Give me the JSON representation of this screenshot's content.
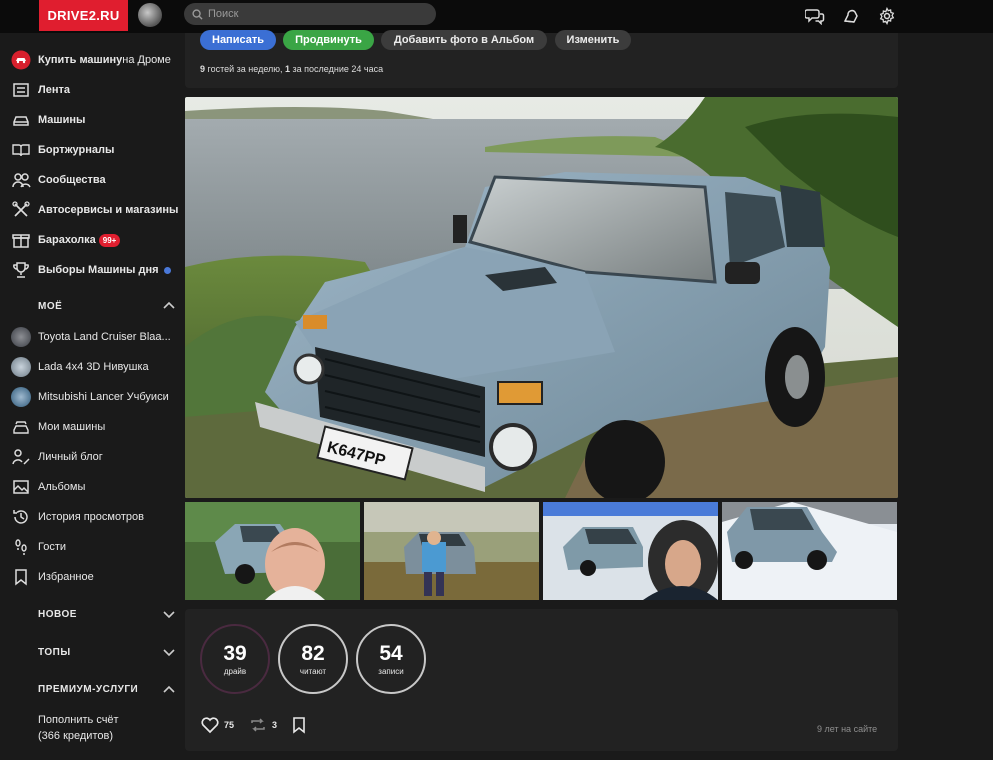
{
  "header": {
    "logo": "DRIVE2.RU",
    "search_placeholder": "Поиск"
  },
  "sidebar": {
    "items": [
      {
        "label_bold": "Купить машину",
        "label_normal": " на Дроме"
      },
      {
        "label": "Лента"
      },
      {
        "label": "Машины"
      },
      {
        "label": "Бортжурналы"
      },
      {
        "label": "Сообщества"
      },
      {
        "label": "Автосервисы и магазины"
      },
      {
        "label": "Барахолка",
        "badge": "99+"
      },
      {
        "label": "Выборы Машины дня"
      }
    ],
    "section_mine": "МОЁ",
    "mine": [
      {
        "label": "Toyota Land Cruiser Blaa..."
      },
      {
        "label": "Lada 4x4 3D Нивушка"
      },
      {
        "label": "Mitsubishi Lancer Учбуиси"
      },
      {
        "label": "Мои машины"
      },
      {
        "label": "Личный блог"
      },
      {
        "label": "Альбомы"
      },
      {
        "label": "История просмотров"
      },
      {
        "label": "Гости"
      },
      {
        "label": "Избранное"
      }
    ],
    "section_new": "НОВОЕ",
    "section_tops": "ТОПЫ",
    "section_premium": "ПРЕМИУМ-УСЛУГИ",
    "credits_line1": "Пополнить счёт",
    "credits_line2": "(366 кредитов)"
  },
  "actions_top": {
    "write": "Написать",
    "promote": "Продвинуть",
    "add_photo": "Добавить фото в Альбом",
    "edit": "Изменить",
    "guests_week": "9",
    "guests_week_text": " гостей за неделю, ",
    "guests_day": "1",
    "guests_day_text": " за последние 24 часа"
  },
  "stats": {
    "drive_num": "39",
    "drive_lbl": "драйв",
    "read_num": "82",
    "read_lbl": "читают",
    "posts_num": "54",
    "posts_lbl": "записи",
    "likes": "75",
    "reposts": "3",
    "years": "9 лет на сайте"
  },
  "colors": {
    "accent_red": "#e01e2f",
    "blue": "#3b6fd4",
    "green": "#3aa545"
  }
}
